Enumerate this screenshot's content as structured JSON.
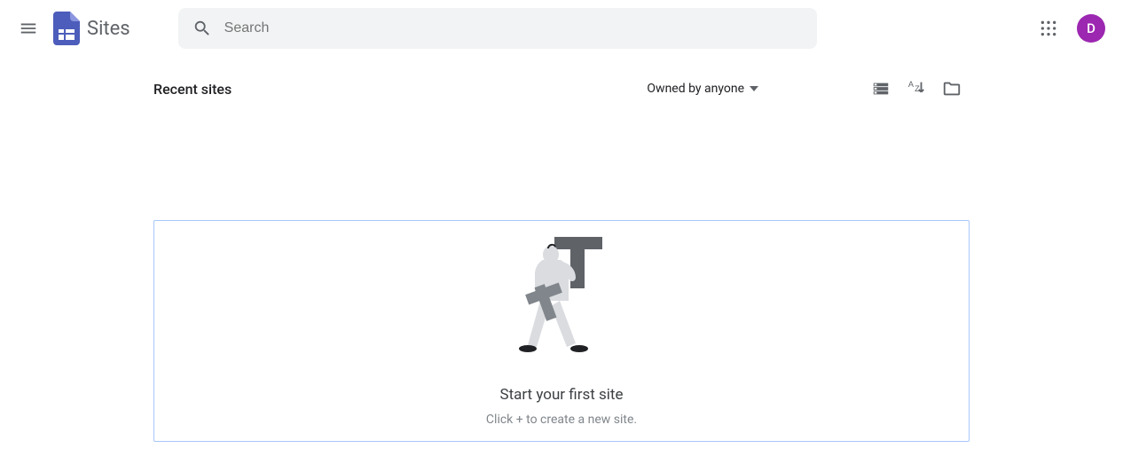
{
  "header": {
    "app_title": "Sites",
    "search_placeholder": "Search",
    "avatar_initial": "D"
  },
  "toolbar": {
    "section_title": "Recent sites",
    "owner_filter_label": "Owned by anyone"
  },
  "empty_state": {
    "title": "Start your first site",
    "subtitle": "Click + to create a new site."
  },
  "colors": {
    "brand": "#4d5dbb",
    "avatar_bg": "#9c27b0",
    "search_bg": "#f1f3f4",
    "card_border": "#a8c7fa"
  }
}
